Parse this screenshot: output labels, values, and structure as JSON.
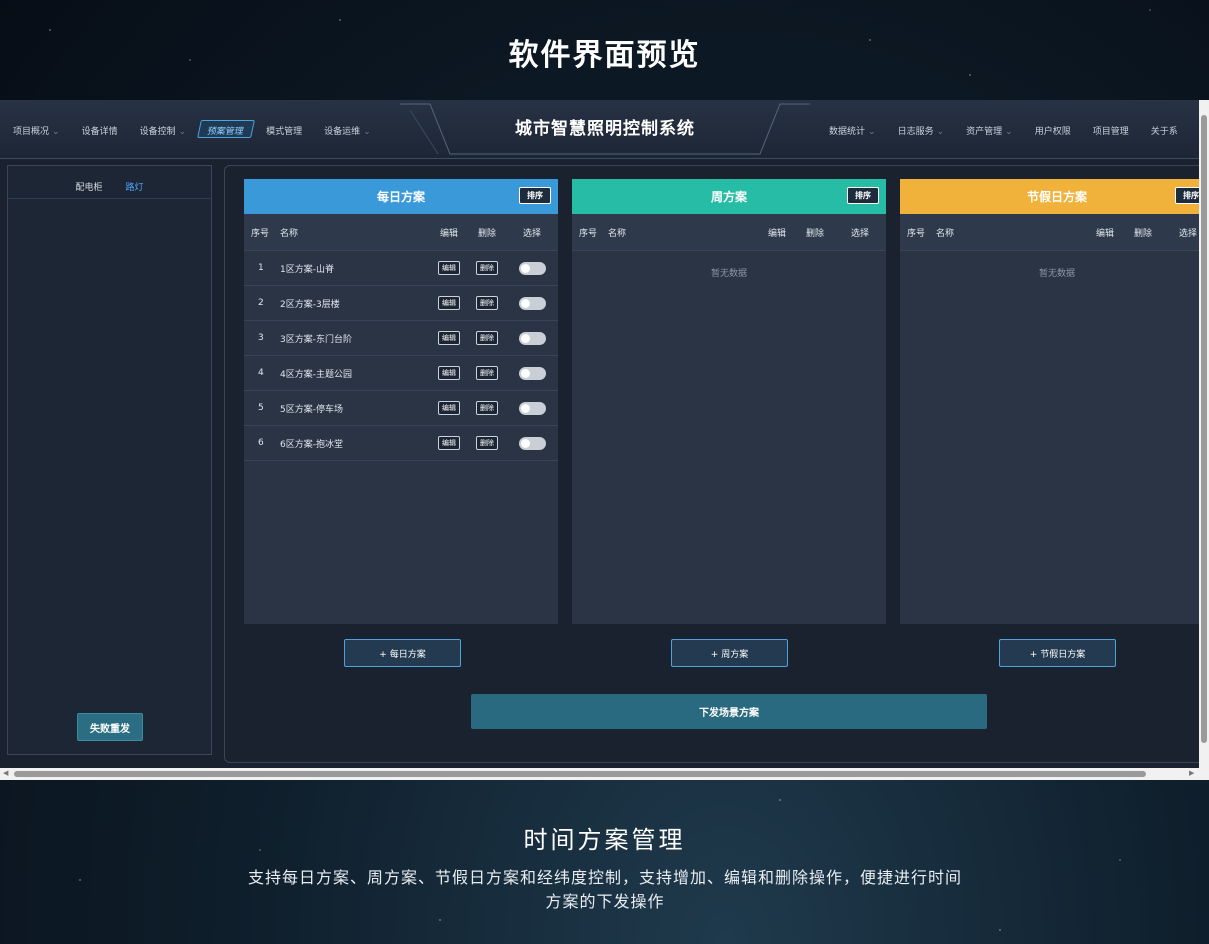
{
  "page_title": "软件界面预览",
  "app": {
    "title": "城市智慧照明控制系统",
    "nav_left": [
      {
        "label": "项目概况",
        "dropdown": true,
        "active": false
      },
      {
        "label": "设备详情",
        "dropdown": false,
        "active": false
      },
      {
        "label": "设备控制",
        "dropdown": true,
        "active": false
      },
      {
        "label": "预案管理",
        "dropdown": false,
        "active": true
      },
      {
        "label": "模式管理",
        "dropdown": false,
        "active": false
      },
      {
        "label": "设备运维",
        "dropdown": true,
        "active": false
      }
    ],
    "nav_right": [
      {
        "label": "数据统计",
        "dropdown": true
      },
      {
        "label": "日志服务",
        "dropdown": true
      },
      {
        "label": "资产管理",
        "dropdown": true
      },
      {
        "label": "用户权限",
        "dropdown": false
      },
      {
        "label": "项目管理",
        "dropdown": false
      },
      {
        "label": "关于系",
        "dropdown": false
      }
    ]
  },
  "left_panel": {
    "tab_cabinet": "配电柜",
    "tab_streetlight": "路灯",
    "retry_button": "失败重发"
  },
  "columns": {
    "no": "序号",
    "name": "名称",
    "edit": "编辑",
    "delete": "删除",
    "select": "选择"
  },
  "row_actions": {
    "edit": "编辑",
    "delete": "删除"
  },
  "plans": {
    "daily": {
      "title": "每日方案",
      "sort": "排序",
      "color": "#3a9ad9",
      "add_button": "+ 每日方案",
      "rows": [
        {
          "no": "1",
          "name": "1区方案-山脊"
        },
        {
          "no": "2",
          "name": "2区方案-3层楼"
        },
        {
          "no": "3",
          "name": "3区方案-东门台阶"
        },
        {
          "no": "4",
          "name": "4区方案-主题公园"
        },
        {
          "no": "5",
          "name": "5区方案-停车场"
        },
        {
          "no": "6",
          "name": "6区方案-抱冰堂"
        }
      ]
    },
    "weekly": {
      "title": "周方案",
      "sort": "排序",
      "color": "#26bca5",
      "add_button": "+ 周方案",
      "empty": "暂无数据"
    },
    "holiday": {
      "title": "节假日方案",
      "sort": "排序",
      "color": "#f0b23a",
      "add_button": "+ 节假日方案",
      "empty": "暂无数据"
    }
  },
  "dispatch_button": "下发场景方案",
  "feature": {
    "title": "时间方案管理",
    "desc_line1": "支持每日方案、周方案、节假日方案和经纬度控制，支持增加、编辑和删除操作，便捷进行时间",
    "desc_line2": "方案的下发操作"
  }
}
